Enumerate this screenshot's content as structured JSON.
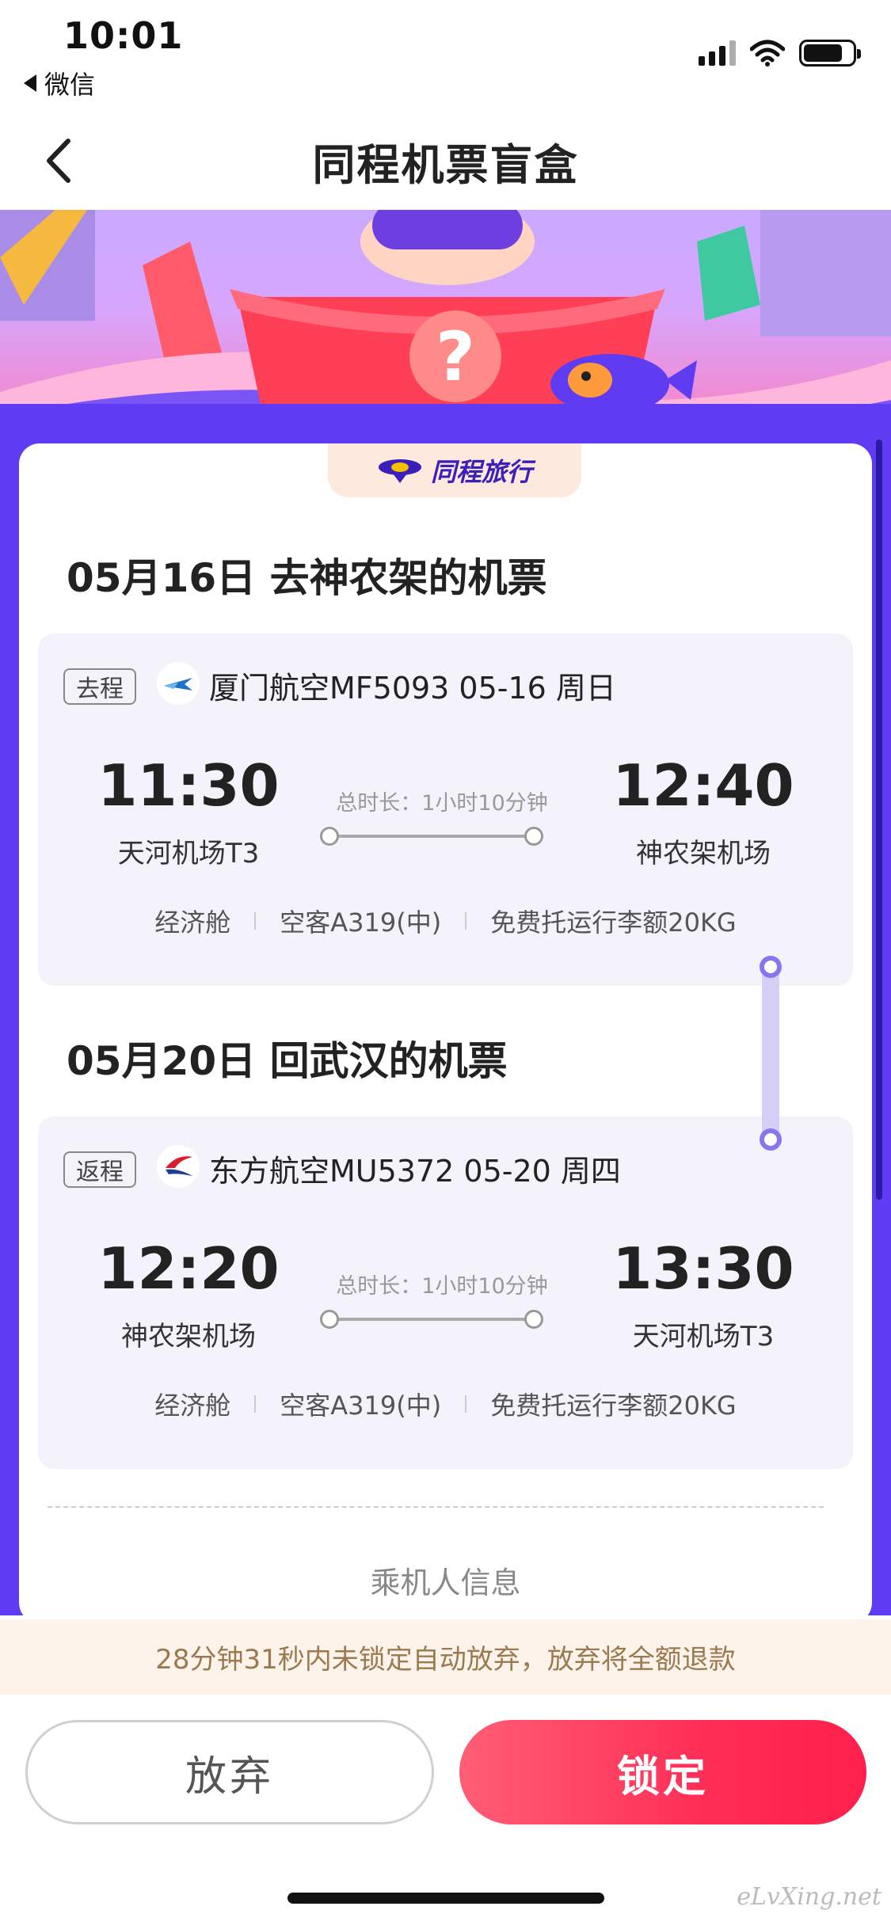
{
  "status_bar": {
    "time": "10:01",
    "back_app": "微信"
  },
  "nav": {
    "title": "同程机票盲盒"
  },
  "brand": {
    "name": "同程旅行"
  },
  "outbound": {
    "section_title": "05月16日 去神农架的机票",
    "trip_tag": "去程",
    "airline_line": "厦门航空MF5093 05-16 周日",
    "dep_time": "11:30",
    "dep_airport": "天河机场T3",
    "duration": "总时长：1小时10分钟",
    "arr_time": "12:40",
    "arr_airport": "神农架机场",
    "cabin": "经济舱",
    "aircraft": "空客A319(中)",
    "baggage": "免费托运行李额20KG"
  },
  "return": {
    "section_title": "05月20日 回武汉的机票",
    "trip_tag": "返程",
    "airline_line": "东方航空MU5372 05-20 周四",
    "dep_time": "12:20",
    "dep_airport": "神农架机场",
    "duration": "总时长：1小时10分钟",
    "arr_time": "13:30",
    "arr_airport": "天河机场T3",
    "cabin": "经济舱",
    "aircraft": "空客A319(中)",
    "baggage": "免费托运行李额20KG"
  },
  "passenger": {
    "label": "乘机人信息"
  },
  "notice": {
    "text": "28分钟31秒内未锁定自动放弃，放弃将全额退款"
  },
  "actions": {
    "abandon_label": "放弃",
    "lock_label": "锁定"
  },
  "watermark": "eLvXing.net",
  "colors": {
    "accent_purple": "#5f3cf2",
    "lock_red": "#ff2e57",
    "notice_text": "#9a7a4e"
  }
}
